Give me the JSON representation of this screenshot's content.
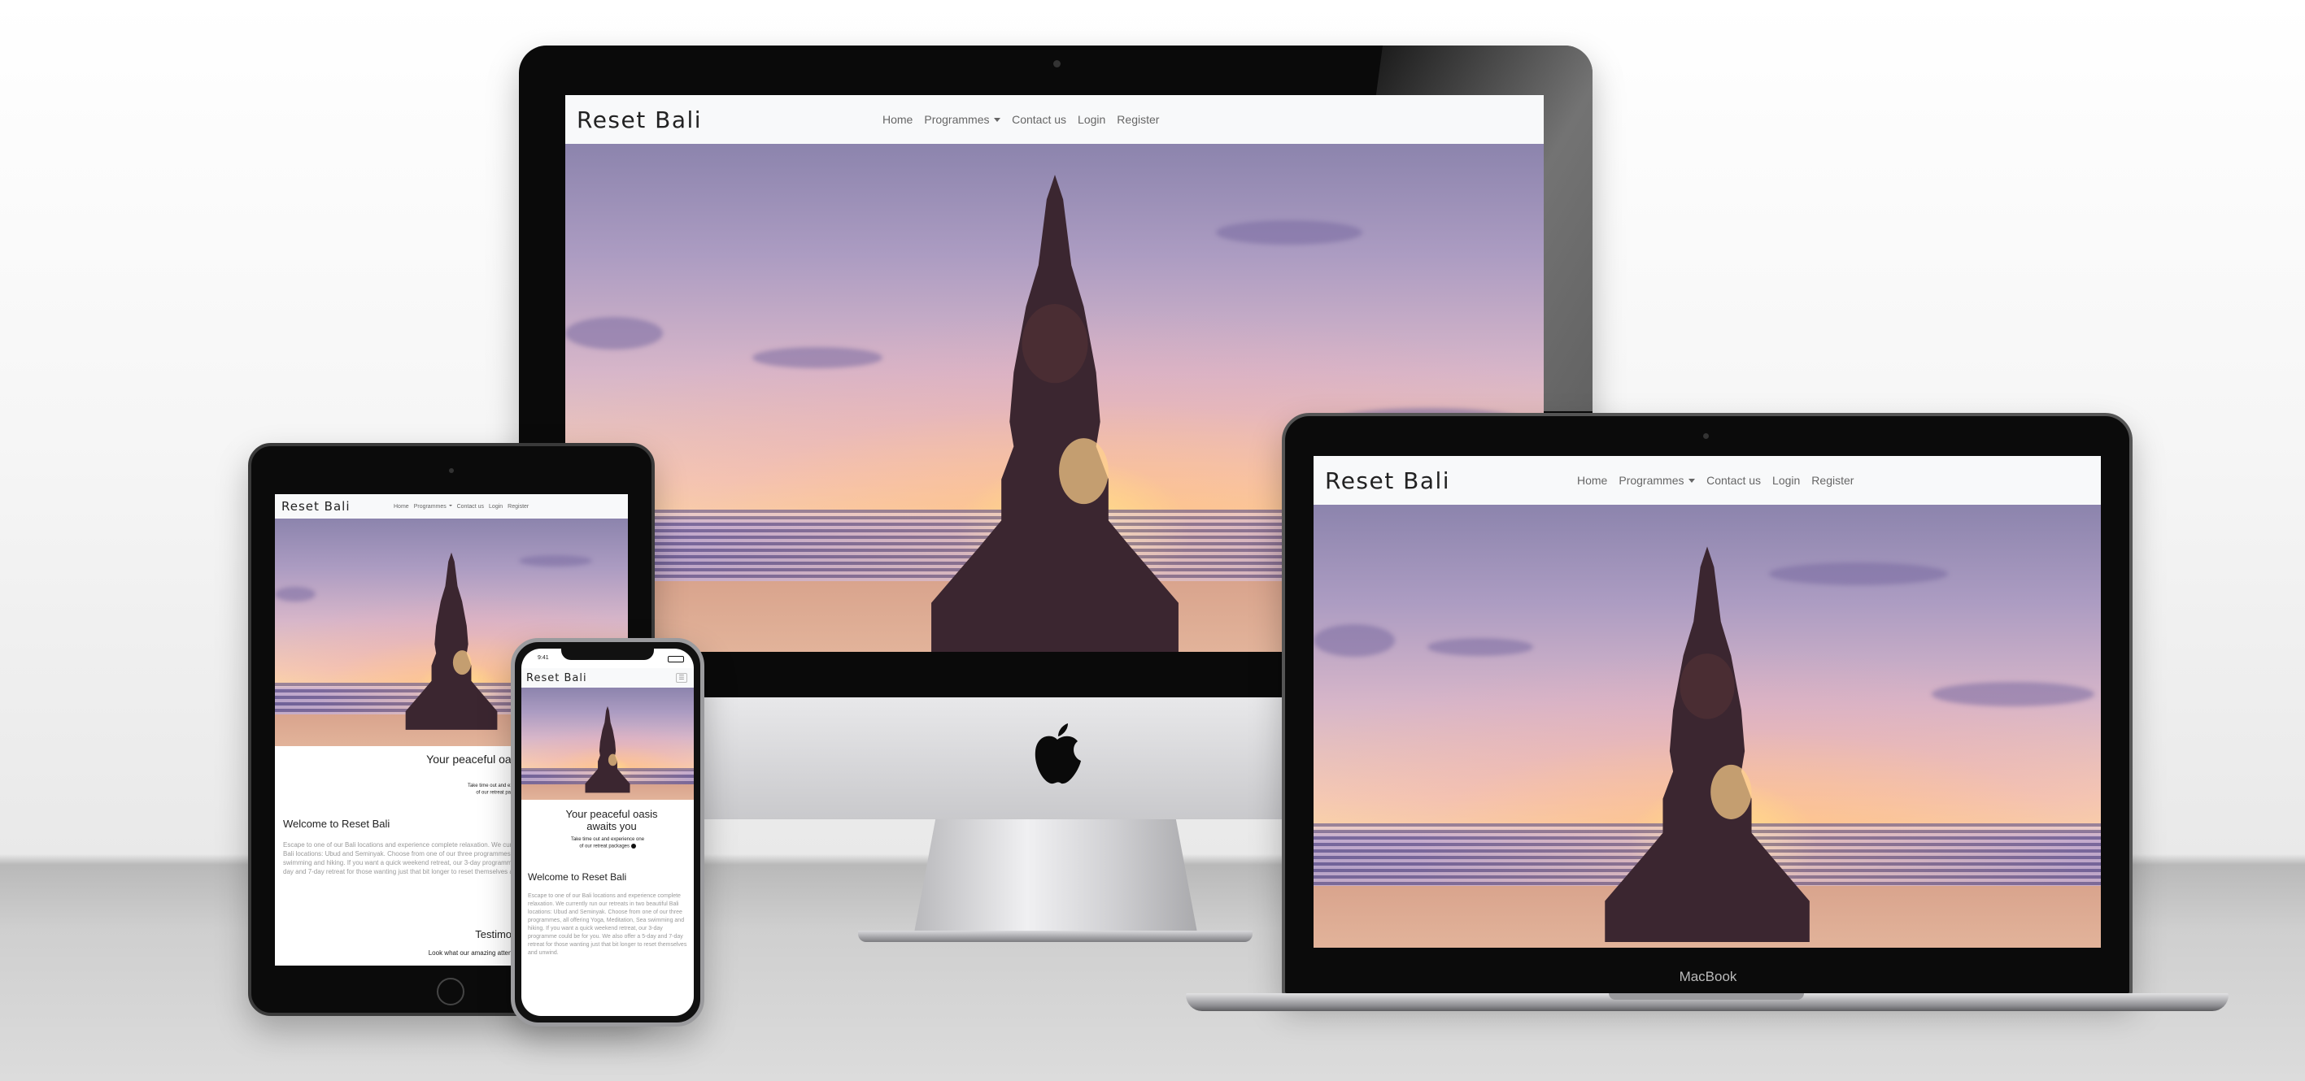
{
  "site": {
    "brand": "Reset Bali",
    "nav": [
      "Home",
      "Programmes",
      "Contact us",
      "Login",
      "Register"
    ],
    "hero_heading": "Your peaceful oasis awaits you",
    "hero_sub_1": "Take time out and experience one",
    "hero_sub_2": "of our retreat packages",
    "welcome_title": "Welcome to Reset Bali",
    "welcome_text_tablet": "Escape to one of our Bali locations and experience complete relaxation. We currently run our retreats in two beautiful Bali locations: Ubud and Seminyak. Choose from one of our three programmes, all offering Yoga, Meditation, Sea swimming and hiking. If you want a quick weekend retreat, our 3-day programme could be for you. We also offer a 5-day and 7-day retreat for those wanting just that bit longer to reset themselves and unwind.",
    "welcome_text_phone": "Escape to one of our Bali locations and experience complete relaxation. We currently run our retreats in two beautiful Bali locations: Ubud and Seminyak. Choose from one of our three programmes, all offering Yoga, Meditation, Sea swimming and hiking. If you want a quick weekend retreat, our 3-day programme could be for you. We also offer a 5-day and 7-day retreat for those wanting just that bit longer to reset themselves and unwind.",
    "testimonials_title": "Testimonials",
    "testimonials_sub": "Look what our amazing attendees have said"
  },
  "phone_status": {
    "time": "9:41"
  },
  "device_labels": {
    "macbook": "MacBook"
  }
}
